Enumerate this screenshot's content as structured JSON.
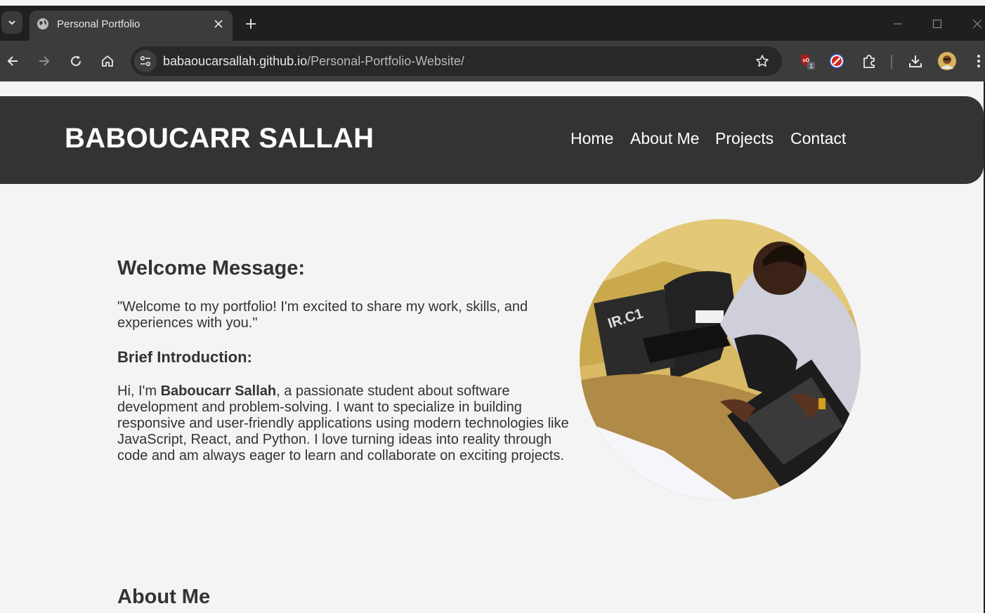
{
  "browser": {
    "tab_title": "Personal Portfolio",
    "url_host": "babaoucarsallah.github.io",
    "url_path": "/Personal-Portfolio-Website/",
    "extension_badge": "1"
  },
  "site": {
    "brand": "BABOUCARR SALLAH",
    "nav": [
      "Home",
      "About Me",
      "Projects",
      "Contact"
    ]
  },
  "hero": {
    "welcome_heading": "Welcome Message:",
    "welcome_text": "\"Welcome to my portfolio! I'm excited to share my work, skills, and experiences with you.\"",
    "intro_heading": "Brief Introduction:",
    "intro_prefix": "Hi, I'm ",
    "intro_name": "Baboucarr Sallah",
    "intro_rest": ", a passionate student about software development and problem-solving. I want to specialize in building responsive and user-friendly applications using modern technologies like JavaScript, React, and Python. I love turning ideas into reality through code and am always eager to learn and collaborate on exciting projects."
  },
  "about": {
    "heading": "About Me"
  },
  "colors": {
    "header_bg": "#333333",
    "page_bg": "#f4f4f4",
    "text": "#333333"
  }
}
